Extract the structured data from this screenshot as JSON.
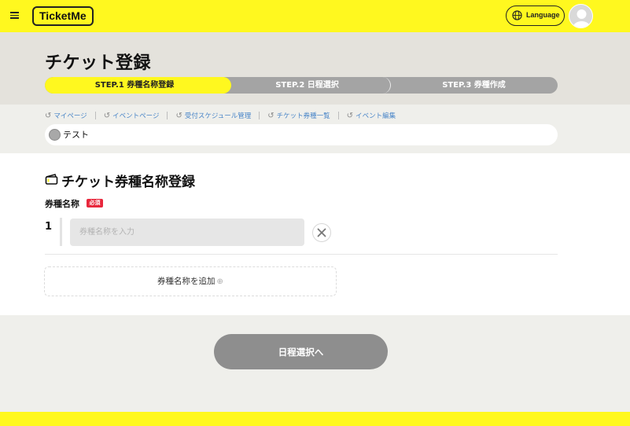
{
  "header": {
    "logo_text": "TicketMe",
    "language_label": "Language"
  },
  "page": {
    "title": "チケット登録"
  },
  "steps": [
    {
      "label": "STEP.1 券種名称登録",
      "active": true
    },
    {
      "label": "STEP.2 日程選択",
      "active": false
    },
    {
      "label": "STEP.3 券種作成",
      "active": false
    }
  ],
  "breadcrumbs": [
    "マイページ",
    "イベントページ",
    "受付スケジュール管理",
    "チケット券種一覧",
    "イベント編集"
  ],
  "event": {
    "name": "テスト"
  },
  "form": {
    "section_title": "チケット券種名称登録",
    "field_label": "券種名称",
    "required_badge": "必須",
    "rows": [
      {
        "number": "1",
        "value": "",
        "placeholder": "券種名称を入力"
      }
    ],
    "add_button_label": "券種名称を追加",
    "add_icon": "⊕"
  },
  "actions": {
    "next_button_label": "日程選択へ"
  },
  "colors": {
    "brand_yellow": "#fff81f",
    "disabled_gray": "#8e8e8e",
    "required_red": "#e8273c",
    "link_blue": "#4a86c8"
  }
}
